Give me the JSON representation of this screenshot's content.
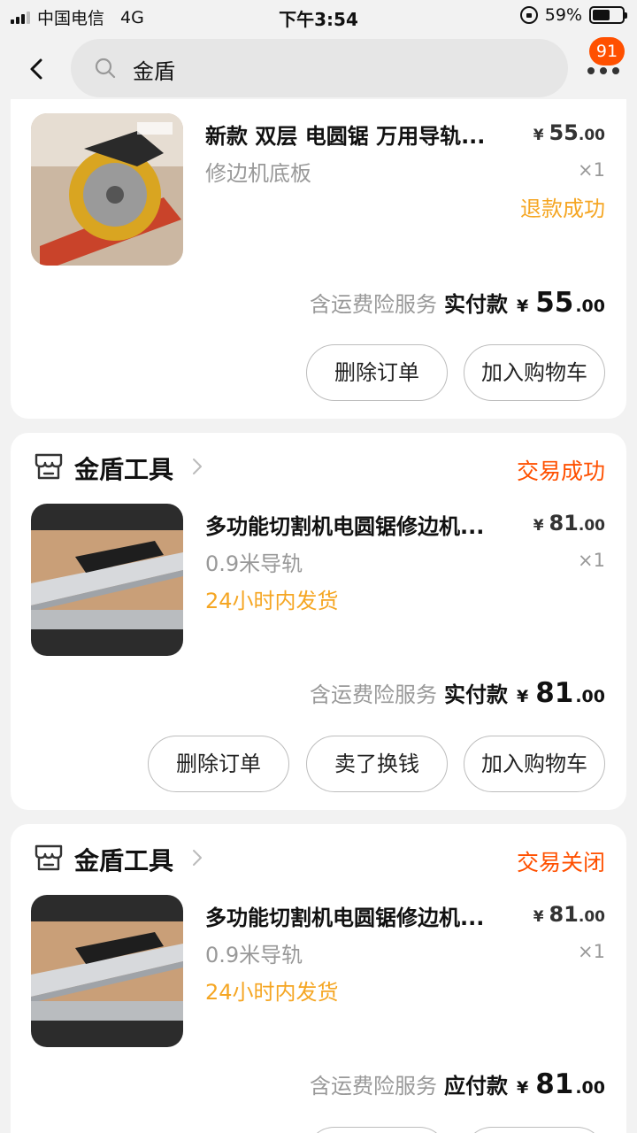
{
  "status_bar": {
    "carrier": "中国电信",
    "network": "4G",
    "time": "下午3:54",
    "battery": "59%",
    "battery_level": 0.59
  },
  "nav": {
    "search_value": "金盾",
    "badge_count": "91",
    "icons": [
      "back-icon",
      "search-icon",
      "more-icon"
    ]
  },
  "orders": [
    {
      "title": "新款 双层 电圆锯 万用导轨...",
      "sku": "修边机底板",
      "price_currency": "¥",
      "price_int": "55",
      "price_dec": ".00",
      "qty": "×1",
      "refund_status": "退款成功",
      "service": "含运费险服务",
      "paid_label": "实付款",
      "total_currency": "¥",
      "total_int": "55",
      "total_dec": ".00",
      "buttons": [
        "删除订单",
        "加入购物车"
      ]
    },
    {
      "store": "金盾工具",
      "status": "交易成功",
      "title": "多功能切割机电圆锯修边机...",
      "sku": "0.9米导轨",
      "note": "24小时内发货",
      "price_currency": "¥",
      "price_int": "81",
      "price_dec": ".00",
      "qty": "×1",
      "service": "含运费险服务",
      "paid_label": "实付款",
      "total_currency": "¥",
      "total_int": "81",
      "total_dec": ".00",
      "buttons": [
        "删除订单",
        "卖了换钱",
        "加入购物车"
      ]
    },
    {
      "store": "金盾工具",
      "status": "交易关闭",
      "title": "多功能切割机电圆锯修边机...",
      "sku": "0.9米导轨",
      "note": "24小时内发货",
      "price_currency": "¥",
      "price_int": "81",
      "price_dec": ".00",
      "qty": "×1",
      "service": "含运费险服务",
      "paid_label": "应付款",
      "total_currency": "¥",
      "total_int": "81",
      "total_dec": ".00"
    }
  ],
  "colors": {
    "accent": "#ff5000",
    "note": "#f5a623",
    "muted": "#999999",
    "background": "#f2f2f2"
  }
}
